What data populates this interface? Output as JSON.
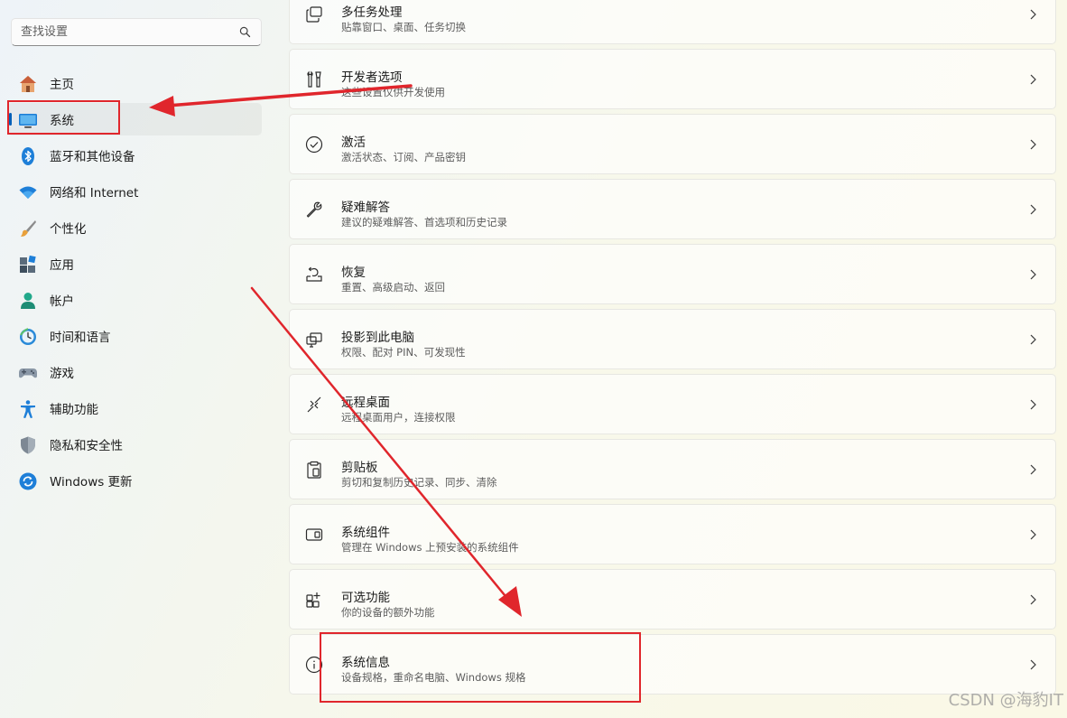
{
  "search": {
    "placeholder": "查找设置",
    "icon": "search-icon"
  },
  "sidebar": {
    "items": [
      {
        "label": "主页",
        "icon": "home-icon"
      },
      {
        "label": "系统",
        "icon": "system-display-icon",
        "selected": true
      },
      {
        "label": "蓝牙和其他设备",
        "icon": "bluetooth-icon"
      },
      {
        "label": "网络和 Internet",
        "icon": "wifi-icon"
      },
      {
        "label": "个性化",
        "icon": "paintbrush-icon"
      },
      {
        "label": "应用",
        "icon": "apps-icon"
      },
      {
        "label": "帐户",
        "icon": "account-icon"
      },
      {
        "label": "时间和语言",
        "icon": "globe-clock-icon"
      },
      {
        "label": "游戏",
        "icon": "gamepad-icon"
      },
      {
        "label": "辅助功能",
        "icon": "accessibility-icon"
      },
      {
        "label": "隐私和安全性",
        "icon": "shield-icon"
      },
      {
        "label": "Windows 更新",
        "icon": "windows-update-icon"
      }
    ]
  },
  "main": {
    "cards": [
      {
        "title": "多任务处理",
        "subtitle": "贴靠窗口、桌面、任务切换",
        "icon": "multitasking-icon"
      },
      {
        "title": "开发者选项",
        "subtitle": "这些设置仅供开发使用",
        "icon": "developer-tools-icon"
      },
      {
        "title": "激活",
        "subtitle": "激活状态、订阅、产品密钥",
        "icon": "activation-check-icon"
      },
      {
        "title": "疑难解答",
        "subtitle": "建议的疑难解答、首选项和历史记录",
        "icon": "wrench-icon"
      },
      {
        "title": "恢复",
        "subtitle": "重置、高级启动、返回",
        "icon": "recovery-icon"
      },
      {
        "title": "投影到此电脑",
        "subtitle": "权限、配对 PIN、可发现性",
        "icon": "projection-icon"
      },
      {
        "title": "远程桌面",
        "subtitle": "远程桌面用户，连接权限",
        "icon": "remote-desktop-icon"
      },
      {
        "title": "剪贴板",
        "subtitle": "剪切和复制历史记录、同步、清除",
        "icon": "clipboard-icon"
      },
      {
        "title": "系统组件",
        "subtitle": "管理在 Windows 上预安装的系统组件",
        "icon": "system-components-icon"
      },
      {
        "title": "可选功能",
        "subtitle": "你的设备的额外功能",
        "icon": "optional-features-icon"
      },
      {
        "title": "系统信息",
        "subtitle": "设备规格，重命名电脑、Windows 规格",
        "icon": "info-icon"
      }
    ]
  },
  "annotations": {
    "highlight_color": "#e0262c"
  },
  "watermark": "CSDN @海豹IT",
  "colors": {
    "accent": "#005fb8",
    "annotation_red": "#e0262c"
  }
}
